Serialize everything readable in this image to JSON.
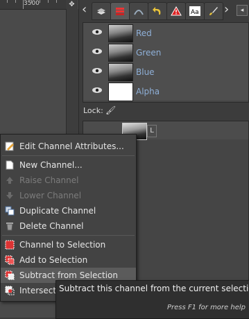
{
  "ruler": {
    "label": "3500"
  },
  "channels_panel": {
    "channels": [
      {
        "name": "Red",
        "thumb": "image"
      },
      {
        "name": "Green",
        "thumb": "image"
      },
      {
        "name": "Blue",
        "thumb": "image"
      },
      {
        "name": "Alpha",
        "thumb": "white"
      }
    ],
    "lock_label": "Lock:",
    "preview_badge": "L"
  },
  "context_menu": {
    "items": [
      {
        "label": "Edit Channel Attributes...",
        "icon": "edit-attributes-icon",
        "enabled": true
      },
      {
        "label": "New Channel...",
        "icon": "new-channel-icon",
        "enabled": true
      },
      {
        "label": "Raise Channel",
        "icon": "raise-icon",
        "enabled": false
      },
      {
        "label": "Lower Channel",
        "icon": "lower-icon",
        "enabled": false
      },
      {
        "label": "Duplicate Channel",
        "icon": "duplicate-icon",
        "enabled": true
      },
      {
        "label": "Delete Channel",
        "icon": "delete-icon",
        "enabled": true
      },
      {
        "label": "Channel to Selection",
        "icon": "channel-to-selection-icon",
        "enabled": true
      },
      {
        "label": "Add to Selection",
        "icon": "add-to-selection-icon",
        "enabled": true
      },
      {
        "label": "Subtract from Selection",
        "icon": "subtract-from-selection-icon",
        "enabled": true,
        "hovered": true
      },
      {
        "label": "Intersect with Selection",
        "icon": "intersect-selection-icon",
        "enabled": true
      }
    ]
  },
  "tooltip": {
    "text": "Subtract this channel from the current selection",
    "help": "Press F1 for more help"
  },
  "colors": {
    "channel_name": "#8fb0d8",
    "menu_hover": "#5b5b5b",
    "tooltip_bg": "#2f2f2f"
  }
}
